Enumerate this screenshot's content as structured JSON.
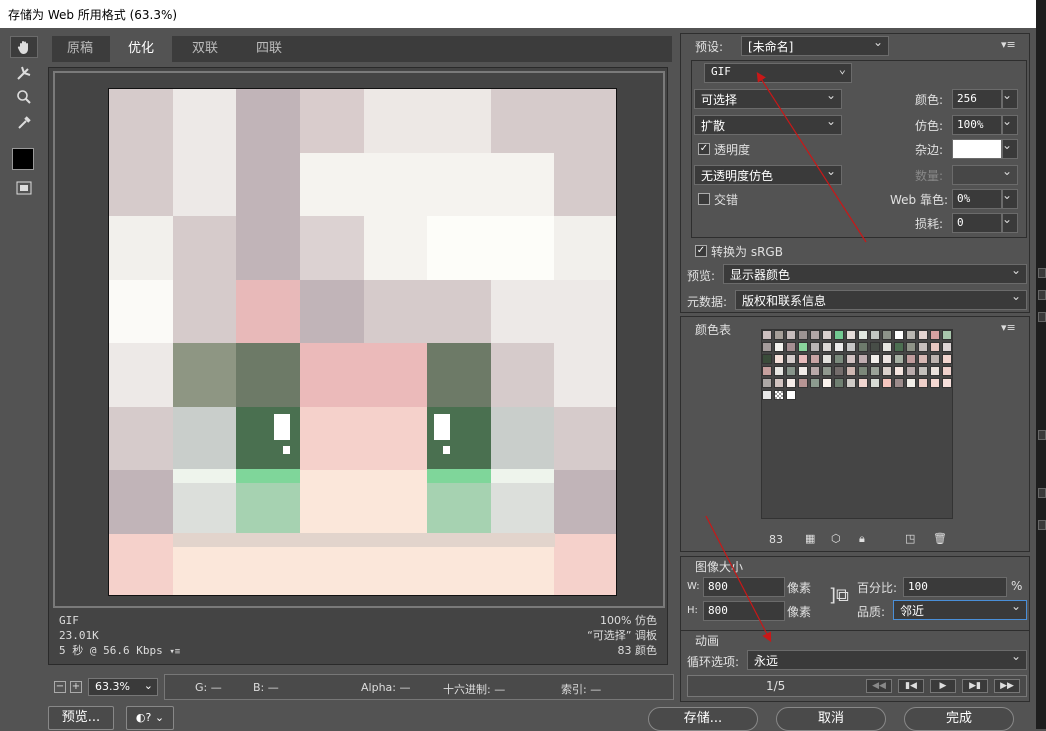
{
  "window": {
    "title": "存储为 Web 所用格式 (63.3%)"
  },
  "tools": [
    "hand-icon",
    "slice-select-icon",
    "zoom-icon",
    "eyedropper-icon",
    "eyedropper-color-swatch",
    "toggle-slices-icon"
  ],
  "tabs": [
    {
      "label": "原稿",
      "active": false
    },
    {
      "label": "优化",
      "active": true
    },
    {
      "label": "双联",
      "active": false
    },
    {
      "label": "四联",
      "active": false
    }
  ],
  "image_info": {
    "format": "GIF",
    "size": "23.01K",
    "speed": "5 秒 @ 56.6 Kbps",
    "dither_pct": "100% 仿色",
    "palette": "“可选择” 调板",
    "colors": "83 颜色"
  },
  "bottom": {
    "zoom": "63.3%",
    "readout": {
      "r": "G: —",
      "b": "B: —",
      "alpha": "Alpha: —",
      "hex": "十六进制: —",
      "index": "索引: —"
    },
    "preview_btn": "预览...",
    "save_btn": "存储...",
    "cancel_btn": "取消",
    "done_btn": "完成"
  },
  "settings": {
    "preset_label": "预设:",
    "preset_value": "[未命名]",
    "format_value": "GIF",
    "reduction_value": "可选择",
    "colors_label": "颜色:",
    "colors_value": "256",
    "dither_method": "扩散",
    "dither_label": "仿色:",
    "dither_value": "100%",
    "transparency_label": "透明度",
    "transparency_checked": true,
    "matte_label": "杂边:",
    "trans_dither": "无透明度仿色",
    "amount_label": "数量:",
    "interlaced_label": "交错",
    "interlaced_checked": false,
    "websnap_label": "Web 靠色:",
    "websnap_value": "0%",
    "lossy_label": "损耗:",
    "lossy_value": "0",
    "srgb_label": "转换为 sRGB",
    "srgb_checked": true,
    "preview_label": "预览:",
    "preview_value": "显示器颜色",
    "metadata_label": "元数据:",
    "metadata_value": "版权和联系信息"
  },
  "color_table": {
    "title": "颜色表",
    "count": "83",
    "colors": [
      "#cbbfbf",
      "#a59e98",
      "#c6bcbc",
      "#9c9392",
      "#b1a6a6",
      "#d9d0ce",
      "#72c991",
      "#e4dcd9",
      "#e1e7e0",
      "#c2c6c2",
      "#8d938a",
      "#ffffff",
      "#b9b6b1",
      "#e3d3d0",
      "#d5a0a0",
      "#a8c6ac",
      "#a49b9b",
      "#f3f2ee",
      "#a68f92",
      "#8ad59c",
      "#b9b5b5",
      "#dcd8d6",
      "#ebeaea",
      "#c7c7c7",
      "#6d7a6c",
      "#474d47",
      "#e6e6e1",
      "#4d6f52",
      "#8f9488",
      "#c7c0be",
      "#e7c7c1",
      "#ded6d6",
      "#3a4c3a",
      "#f5e0da",
      "#d5cccb",
      "#e8bcbc",
      "#c8a3a3",
      "#e2e1dd",
      "#7b8b7d",
      "#d1c2c2",
      "#c0aeb1",
      "#f1eeea",
      "#ebe3e1",
      "#a7b1a4",
      "#c09c9d",
      "#d7b8b4",
      "#bcb2ae",
      "#f2d5cf",
      "#c6a09e",
      "#e7e6e2",
      "#88958b",
      "#f1ebe8",
      "#b8a8a8",
      "#90998f",
      "#746d6c",
      "#cdb7b1",
      "#7c887a",
      "#9aa298",
      "#dad1cc",
      "#f4e4df",
      "#b9acac",
      "#c4c0bc",
      "#eae1dc",
      "#efd1cc",
      "#ada8a6",
      "#d2c4c1",
      "#f6ede9",
      "#b79594",
      "#8c9b8f",
      "#fbf4ee",
      "#6f7f71",
      "#cfcbc7",
      "#f0d6d0",
      "#d8dcd6",
      "#f6c6bf",
      "#9c8b8b",
      "#f2efe9",
      "#eecfc9",
      "#f5d9d2",
      "#f7e0dc",
      "#e6e6e6",
      "transparent",
      "#ffffff"
    ]
  },
  "image_size": {
    "title": "图像大小",
    "w_label": "W:",
    "w_value": "800",
    "h_label": "H:",
    "h_value": "800",
    "unit": "像素",
    "percent_label": "百分比:",
    "percent_value": "100",
    "percent_unit": "%",
    "quality_label": "品质:",
    "quality_value": "邻近"
  },
  "animation": {
    "title": "动画",
    "loop_label": "循环选项:",
    "loop_value": "永远",
    "frame": "1/5"
  },
  "pixel_art": {
    "rows": [
      [
        "#d6cbcb",
        "#ede9e7",
        "#c1b4b8",
        "#d9cccc",
        "#ede8e5",
        "#ede8e5",
        "#d6cbcb",
        "#d6cbcb"
      ],
      [
        "#d6cbcb",
        "#ede9e7",
        "#c1b4b8",
        "#f5f3ef",
        "#f5f3ef",
        "#f5f3ef",
        "#f5f3ef",
        "#d6cbcb"
      ],
      [
        "#f2f0ec",
        "#d6cbcb",
        "#c1b4b8",
        "#dcd2d2",
        "#f5f3ef",
        "#fdfdf9",
        "#fdfdf9",
        "#f2f0ec"
      ],
      [
        "#fbfaf7",
        "#d6cbcb",
        "#e8b9b9",
        "#c1b4b8",
        "#d6cbcb",
        "#d6cbcb",
        "#ede9e7",
        "#ede9e7"
      ],
      [
        "#ede9e7",
        "#8e9683",
        "#6d7a67",
        "#ebbaba",
        "#ebbaba",
        "#6d7a67",
        "#d6cbcb",
        "#ede9e7"
      ],
      [
        "#d6cbcb",
        "#c9cecb",
        "#4a7050",
        "#f5d1cb",
        "#f5d1cb",
        "#4a7050",
        "#c9cecb",
        "#d6cbcb"
      ],
      [
        "#c1b4b8",
        "#dcdfdb",
        "#a6d2b1",
        "#fbe7da",
        "#fbe7da",
        "#a6d2b1",
        "#dcdfdb",
        "#c1b4b8"
      ],
      [
        "#f5d1cb",
        "#fbe7da",
        "#fbe7da",
        "#fbe7da",
        "#fbe7da",
        "#fbe7da",
        "#fbe7da",
        "#f5d1cb"
      ]
    ]
  }
}
